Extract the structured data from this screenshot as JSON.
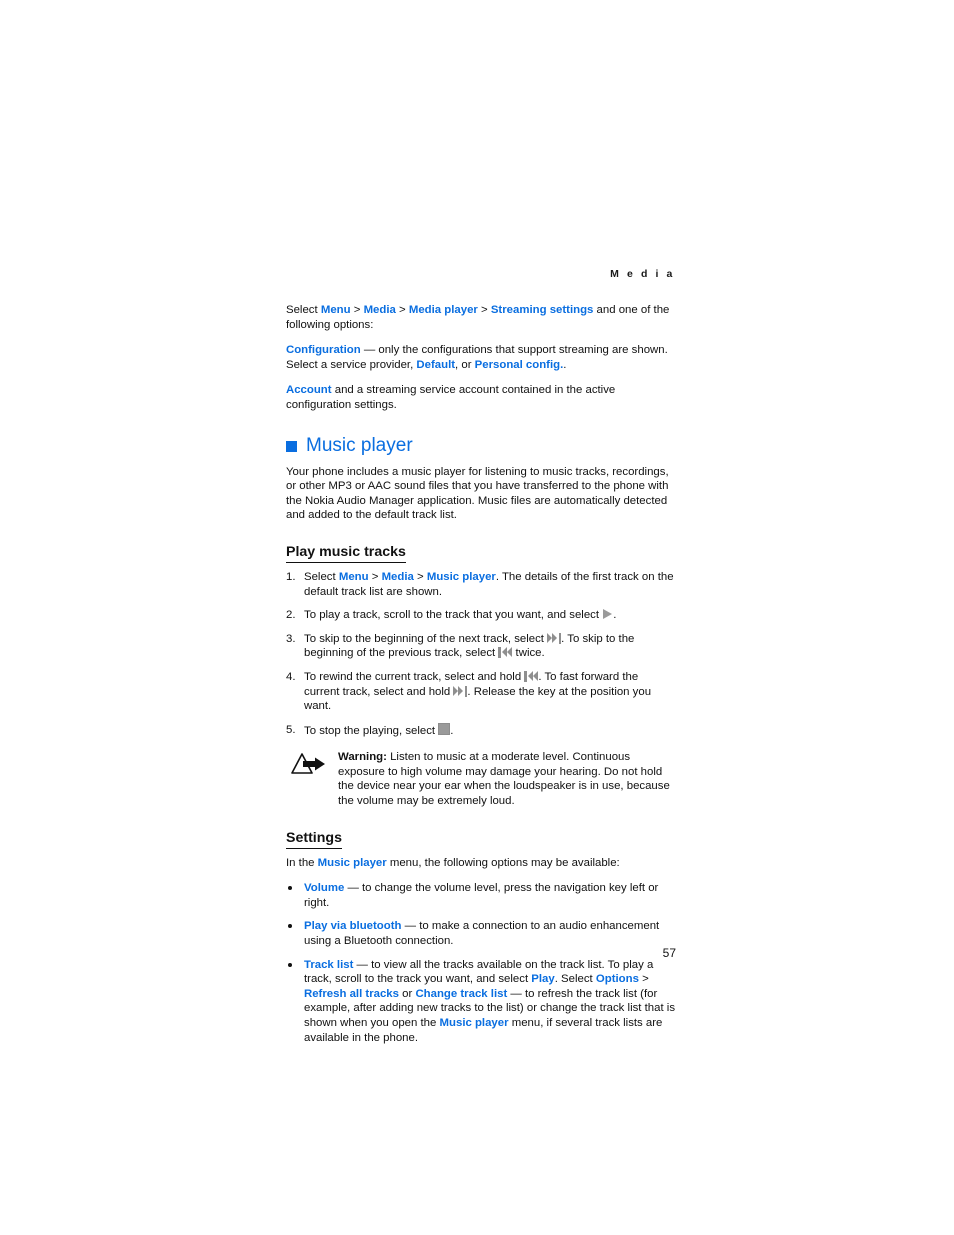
{
  "page": {
    "running_head": "M e d i a",
    "page_number": "57",
    "accent_color": "#0a6ee0",
    "icon_gray": "#9a9a9a"
  },
  "streaming": {
    "intro_pre": "Select ",
    "menu": "Menu",
    "sep1": " > ",
    "media": "Media",
    "sep2": " > ",
    "media_player": "Media player",
    "sep3": " > ",
    "streaming_settings": "Streaming settings",
    "intro_post": " and one of the following options:",
    "configuration_term": "Configuration",
    "configuration_desc": " — only the configurations that support streaming are shown. Select a service provider, ",
    "default_term": "Default",
    "configuration_desc2": ", or ",
    "personal_config_term": "Personal config.",
    "configuration_desc3": ".",
    "account_term": "Account",
    "account_desc": " and a streaming service account contained in the active configuration settings."
  },
  "music_player": {
    "heading": "Music player",
    "intro": "Your phone includes a music player for listening to music tracks, recordings, or other MP3 or AAC sound files that you have transferred to the phone with the Nokia Audio Manager application. Music files are automatically detected and added to the default track list."
  },
  "play_music_tracks": {
    "heading": "Play music tracks",
    "steps": [
      {
        "num": "1.",
        "pre": "Select ",
        "link1": "Menu",
        "sep1": " > ",
        "link2": "Media",
        "sep2": " > ",
        "link3": "Music player",
        "post": ". The details of the first track on the default track list are shown."
      },
      {
        "num": "2.",
        "pre": "To play a track, scroll to the track that you want, and select ",
        "icon": "play-icon",
        "post": "."
      },
      {
        "num": "3.",
        "pre": "To skip to the beginning of the next track, select ",
        "icon": "next-track-icon",
        "mid": ". To skip to the beginning of the previous track, select ",
        "icon2": "previous-track-icon",
        "post": " twice."
      },
      {
        "num": "4.",
        "pre": "To rewind the current track, select and hold ",
        "icon": "previous-track-icon",
        "mid": ". To fast forward the current track, select and hold ",
        "icon2": "next-track-icon",
        "post": ". Release the key at the position you want."
      },
      {
        "num": "5.",
        "pre": "To stop the playing, select ",
        "icon": "stop-icon",
        "post": "."
      }
    ]
  },
  "warning": {
    "icon": "warning-triangle-icon",
    "label": "Warning:",
    "text": " Listen to music at a moderate level. Continuous exposure to high volume may damage your hearing. Do not hold the device near your ear when the loudspeaker is in use, because the volume may be extremely loud."
  },
  "settings": {
    "heading": "Settings",
    "intro_pre": "In the ",
    "intro_link": "Music player",
    "intro_post": " menu, the following options may be available:",
    "items": [
      {
        "term": "Volume",
        "desc": " — to change the volume level, press the navigation key left or right."
      },
      {
        "term": "Play via bluetooth",
        "desc": " — to make a connection to an audio enhancement using a Bluetooth connection."
      },
      {
        "term": "Track list",
        "desc1": " — to view all the tracks available on the track list. To play a track, scroll to the track you want, and select ",
        "play_link": "Play",
        "desc2": ". Select ",
        "options_link": "Options",
        "desc3": " > ",
        "refresh_link": "Refresh all tracks",
        "desc4": " or ",
        "change_link": "Change track list",
        "desc5": " — to refresh the track list (for example, after adding new tracks to the list) or change the track list that is shown when you open the ",
        "player_link": "Music player",
        "desc6": " menu, if several track lists are available in the phone."
      }
    ]
  }
}
